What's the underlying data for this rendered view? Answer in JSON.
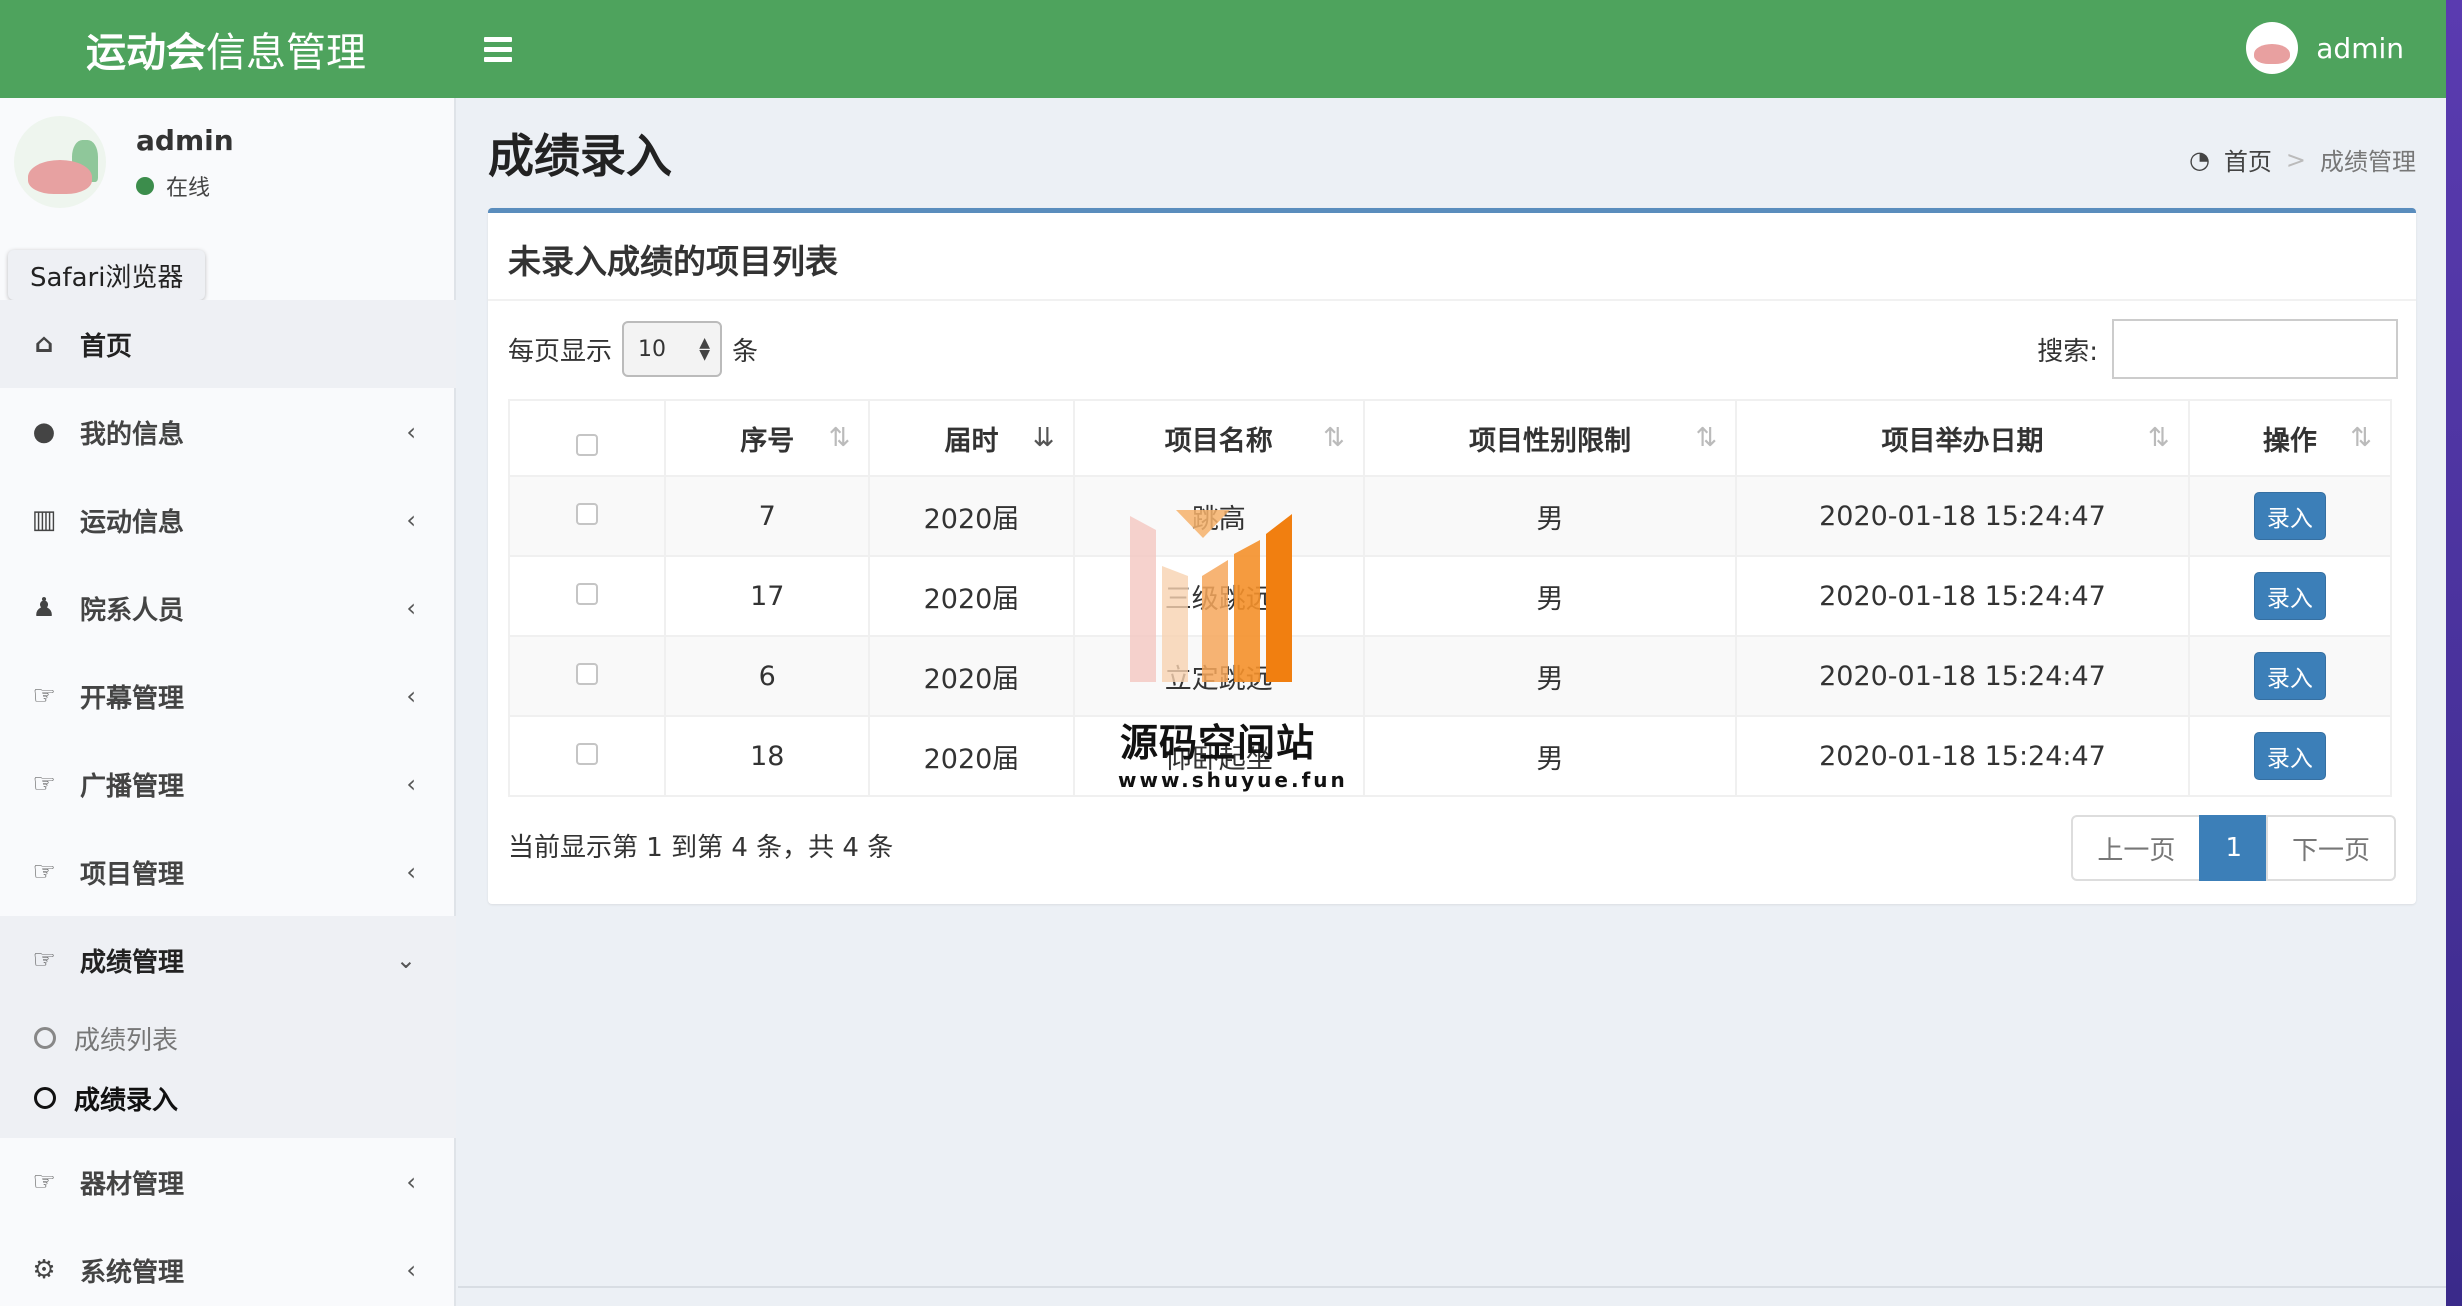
{
  "brand": {
    "strong": "运动会",
    "light": "信息管理"
  },
  "topbar": {
    "user": "admin"
  },
  "sidebar": {
    "user": {
      "name": "admin",
      "status": "在线"
    },
    "tooltip": "Safari浏览器",
    "items": [
      {
        "label": "首页",
        "icon": "home-icon"
      },
      {
        "label": "我的信息",
        "icon": "user-icon"
      },
      {
        "label": "运动信息",
        "icon": "bar-chart-icon"
      },
      {
        "label": "院系人员",
        "icon": "users-icon"
      },
      {
        "label": "开幕管理",
        "icon": "hand-pointer-icon"
      },
      {
        "label": "广播管理",
        "icon": "hand-pointer-icon"
      },
      {
        "label": "项目管理",
        "icon": "hand-pointer-icon"
      },
      {
        "label": "成绩管理",
        "icon": "hand-pointer-icon"
      },
      {
        "label": "器材管理",
        "icon": "hand-pointer-icon"
      },
      {
        "label": "系统管理",
        "icon": "gear-icon"
      }
    ],
    "sub_items": [
      {
        "label": "成绩列表"
      },
      {
        "label": "成绩录入"
      }
    ]
  },
  "page": {
    "title": "成绩录入",
    "breadcrumb": {
      "home": "首页",
      "sep": ">",
      "current": "成绩管理"
    }
  },
  "box": {
    "title": "未录入成绩的项目列表",
    "length": {
      "prefix": "每页显示",
      "value": "10",
      "suffix": "条"
    },
    "search": {
      "label": "搜索:",
      "value": ""
    },
    "columns": [
      "序号",
      "届时",
      "项目名称",
      "项目性别限制",
      "项目举办日期",
      "操作"
    ],
    "rows": [
      {
        "id": "7",
        "term": "2020届",
        "name": "跳高",
        "gender": "男",
        "date": "2020-01-18 15:24:47",
        "action": "录入"
      },
      {
        "id": "17",
        "term": "2020届",
        "name": "三级跳远",
        "gender": "男",
        "date": "2020-01-18 15:24:47",
        "action": "录入"
      },
      {
        "id": "6",
        "term": "2020届",
        "name": "立定跳远",
        "gender": "男",
        "date": "2020-01-18 15:24:47",
        "action": "录入"
      },
      {
        "id": "18",
        "term": "2020届",
        "name": "仰卧起坐",
        "gender": "男",
        "date": "2020-01-18 15:24:47",
        "action": "录入"
      }
    ],
    "info": "当前显示第 1 到第 4 条，共 4 条",
    "pager": {
      "prev": "上一页",
      "current": "1",
      "next": "下一页"
    }
  },
  "watermark": {
    "title": "源码空间站",
    "url": "www.shuyue.fun"
  },
  "colors": {
    "header": "#4ea35d",
    "accent": "#3c7fb8",
    "box_border": "#5a8dbd"
  }
}
